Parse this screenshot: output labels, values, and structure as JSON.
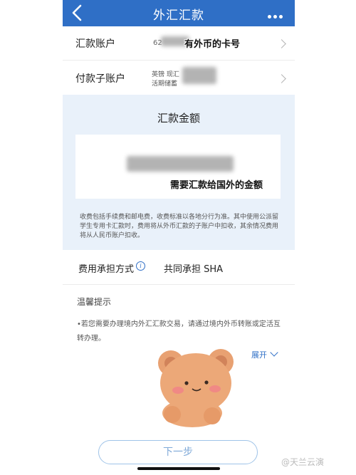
{
  "header": {
    "title": "外汇汇款",
    "back_icon": "chevron-left-icon",
    "more_icon": "more-dots-icon"
  },
  "remit_account": {
    "label": "汇款账户",
    "number_prefix": "62",
    "annotation": "有外币的卡号"
  },
  "payment_subaccount": {
    "label": "付款子账户",
    "line1": "英镑 现汇",
    "line2": "活期储蓄"
  },
  "amount": {
    "title": "汇款金额",
    "annotation": "需要汇款给国外的金额",
    "fee_note": "收费包括手续费和邮电费，收费标准以各地分行为准。其中使用公派留学生专用卡汇款时，费用将从外币汇款的子账户中扣收，其余情况费用将从人民币账户扣收。"
  },
  "fee_bearer": {
    "label": "费用承担方式",
    "info_icon": "info-icon",
    "value": "共同承担 SHA"
  },
  "tips": {
    "title": "温馨提示",
    "text": "•若您需要办理境内外汇汇款交易，请通过境内外币转账或定活互转办理。",
    "expand_label": "展开"
  },
  "next_button": {
    "label": "下一步"
  },
  "watermark": "@天兰云演",
  "colors": {
    "header_bg": "#2f6fc6",
    "amount_section_bg": "#e9f1fa",
    "link": "#2f6fc6"
  }
}
